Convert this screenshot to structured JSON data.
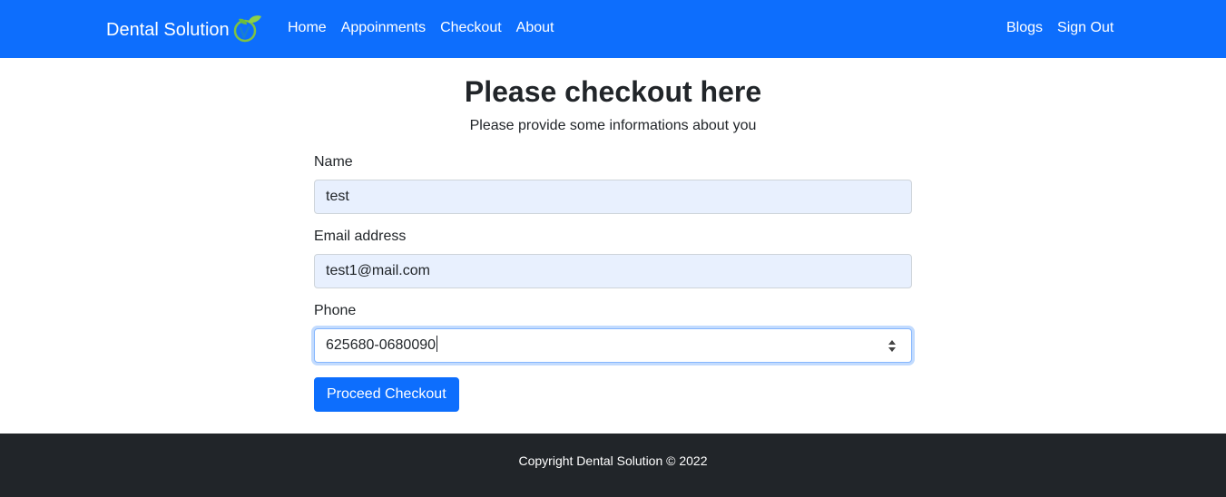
{
  "navbar": {
    "brand": "Dental Solution",
    "links_left": [
      "Home",
      "Appoinments",
      "Checkout",
      "About"
    ],
    "links_right": [
      "Blogs",
      "Sign Out"
    ],
    "background": "#0d6efd"
  },
  "main": {
    "title": "Please checkout here",
    "subtitle": "Please provide some informations about you"
  },
  "form": {
    "name_label": "Name",
    "name_value": "test",
    "email_label": "Email address",
    "email_value": "test1@mail.com",
    "phone_label": "Phone",
    "phone_value": "625680-0680090",
    "submit_label": "Proceed Checkout"
  },
  "footer": {
    "text": "Copyright Dental Solution © 2022",
    "background": "#212529"
  }
}
